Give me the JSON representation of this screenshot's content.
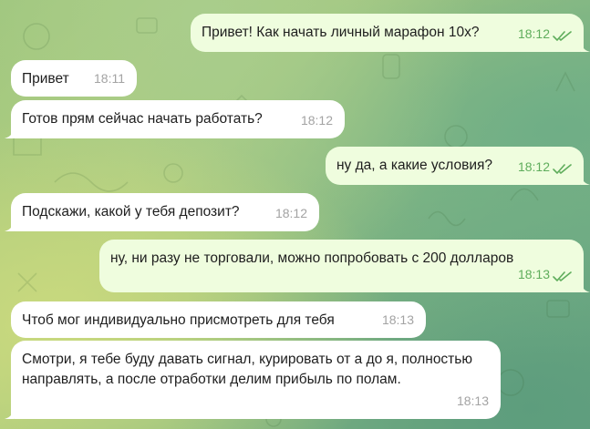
{
  "chat": {
    "messages": [
      {
        "direction": "out",
        "text": "Привет! Как начать личный марафон 10х?",
        "time": "18:12",
        "status": "read-double-check"
      },
      {
        "direction": "in",
        "text": "Привет",
        "time": "18:11"
      },
      {
        "direction": "in",
        "text": "Готов прям сейчас начать работать?",
        "time": "18:12"
      },
      {
        "direction": "out",
        "text": "ну да, а какие условия?",
        "time": "18:12",
        "status": "read-double-check"
      },
      {
        "direction": "in",
        "text": "Подскажи, какой у тебя депозит?",
        "time": "18:12"
      },
      {
        "direction": "out",
        "text": "ну, ни разу не торговали, можно попробовать с 200 долларов",
        "time": "18:13",
        "status": "read-double-check"
      },
      {
        "direction": "in",
        "text": "Чтоб мог индивидуально присмотреть для тебя",
        "time": "18:13"
      },
      {
        "direction": "in",
        "text": "Смотри, я тебе буду давать сигнал, курировать от а до я, полностью направлять, а после отработки делим прибыль по полам.",
        "time": "18:13"
      }
    ]
  },
  "colors": {
    "incoming_bubble": "#ffffff",
    "outgoing_bubble": "#effdde",
    "outgoing_time": "#5fad5c",
    "incoming_time": "#a3a3a3",
    "background_accent": "#8bbb83"
  }
}
